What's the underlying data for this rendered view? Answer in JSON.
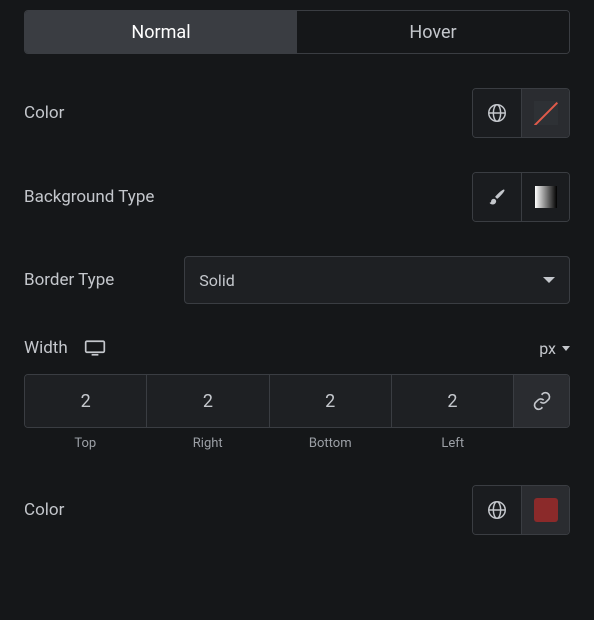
{
  "tabs": {
    "normal": "Normal",
    "hover": "Hover"
  },
  "color1": {
    "label": "Color"
  },
  "bg_type": {
    "label": "Background Type"
  },
  "border_type": {
    "label": "Border Type",
    "value": "Solid"
  },
  "width": {
    "label": "Width",
    "unit": "px",
    "top": "2",
    "right": "2",
    "bottom": "2",
    "left": "2",
    "labels": {
      "top": "Top",
      "right": "Right",
      "bottom": "Bottom",
      "left": "Left"
    }
  },
  "color2": {
    "label": "Color",
    "value": "#8b2a2a"
  }
}
